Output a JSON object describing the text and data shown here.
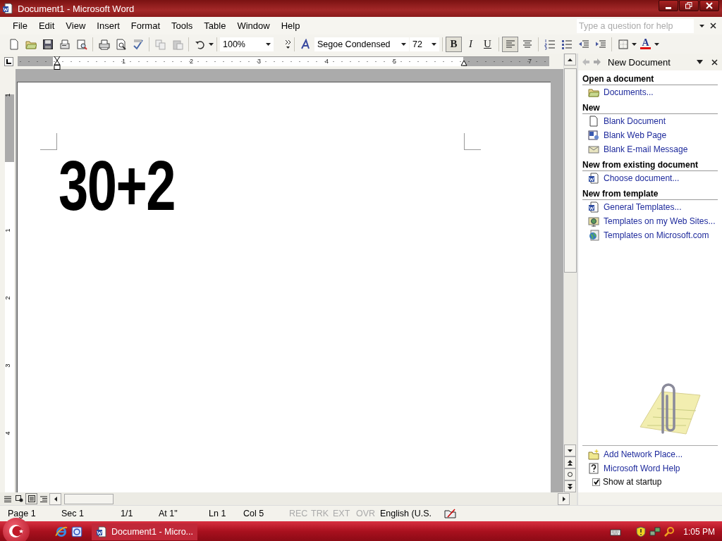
{
  "window": {
    "title": "Document1 - Microsoft Word"
  },
  "menu": [
    "File",
    "Edit",
    "View",
    "Insert",
    "Format",
    "Tools",
    "Table",
    "Window",
    "Help"
  ],
  "help_box": {
    "placeholder": "Type a question for help"
  },
  "toolbar": {
    "zoom": "100%",
    "font": "Segoe Condensed",
    "size": "72",
    "formatting": [
      {
        "kind": "bold",
        "label": "B",
        "selected": true
      },
      {
        "kind": "italic",
        "label": "I",
        "selected": false
      },
      {
        "kind": "underline",
        "label": "U",
        "selected": false
      }
    ],
    "alignment": [
      {
        "kind": "left",
        "selected": true
      },
      {
        "kind": "center",
        "selected": false
      }
    ],
    "font_color": {
      "label": "A"
    }
  },
  "ruler": {
    "labels": [
      "1",
      "2",
      "3",
      "4",
      "5",
      "7"
    ]
  },
  "vertical_ruler": {
    "labels": [
      "1",
      "1",
      "2",
      "3",
      "4"
    ]
  },
  "document": {
    "text": "30+2"
  },
  "task_pane": {
    "title": "New Document",
    "sections": [
      {
        "heading": "Open a document",
        "items": [
          {
            "kind": "folder",
            "label": "Documents..."
          }
        ]
      },
      {
        "heading": "New",
        "items": [
          {
            "kind": "page",
            "label": "Blank Document"
          },
          {
            "kind": "web-page",
            "label": "Blank Web Page"
          },
          {
            "kind": "envelope",
            "label": "Blank E-mail Message"
          }
        ]
      },
      {
        "heading": "New from existing document",
        "items": [
          {
            "kind": "word-doc",
            "label": "Choose document..."
          }
        ]
      },
      {
        "heading": "New from template",
        "items": [
          {
            "kind": "word-doc",
            "label": "General Templates..."
          },
          {
            "kind": "web-folder",
            "label": "Templates on my Web Sites..."
          },
          {
            "kind": "globe",
            "label": "Templates on Microsoft.com"
          }
        ]
      }
    ],
    "footer_links": [
      {
        "kind": "folder-star",
        "label": "Add Network Place..."
      },
      {
        "kind": "help",
        "label": "Microsoft Word Help"
      }
    ],
    "show_at_startup": {
      "label": "Show at startup",
      "checked": true
    }
  },
  "status_bar": [
    {
      "text": "Page 1",
      "disabled": false
    },
    {
      "text": "Sec 1",
      "disabled": false
    },
    {
      "text": "1/1",
      "disabled": false
    },
    {
      "text": "At 1\"",
      "disabled": false
    },
    {
      "text": "Ln 1",
      "disabled": false
    },
    {
      "text": "Col 5",
      "disabled": false
    },
    {
      "text": "REC",
      "disabled": true
    },
    {
      "text": "TRK",
      "disabled": true
    },
    {
      "text": "EXT",
      "disabled": true
    },
    {
      "text": "OVR",
      "disabled": true
    },
    {
      "text": "English (U.S.",
      "disabled": false
    }
  ],
  "taskbar": {
    "task": "Document1 - Micro...",
    "clock": "1:05 PM"
  }
}
